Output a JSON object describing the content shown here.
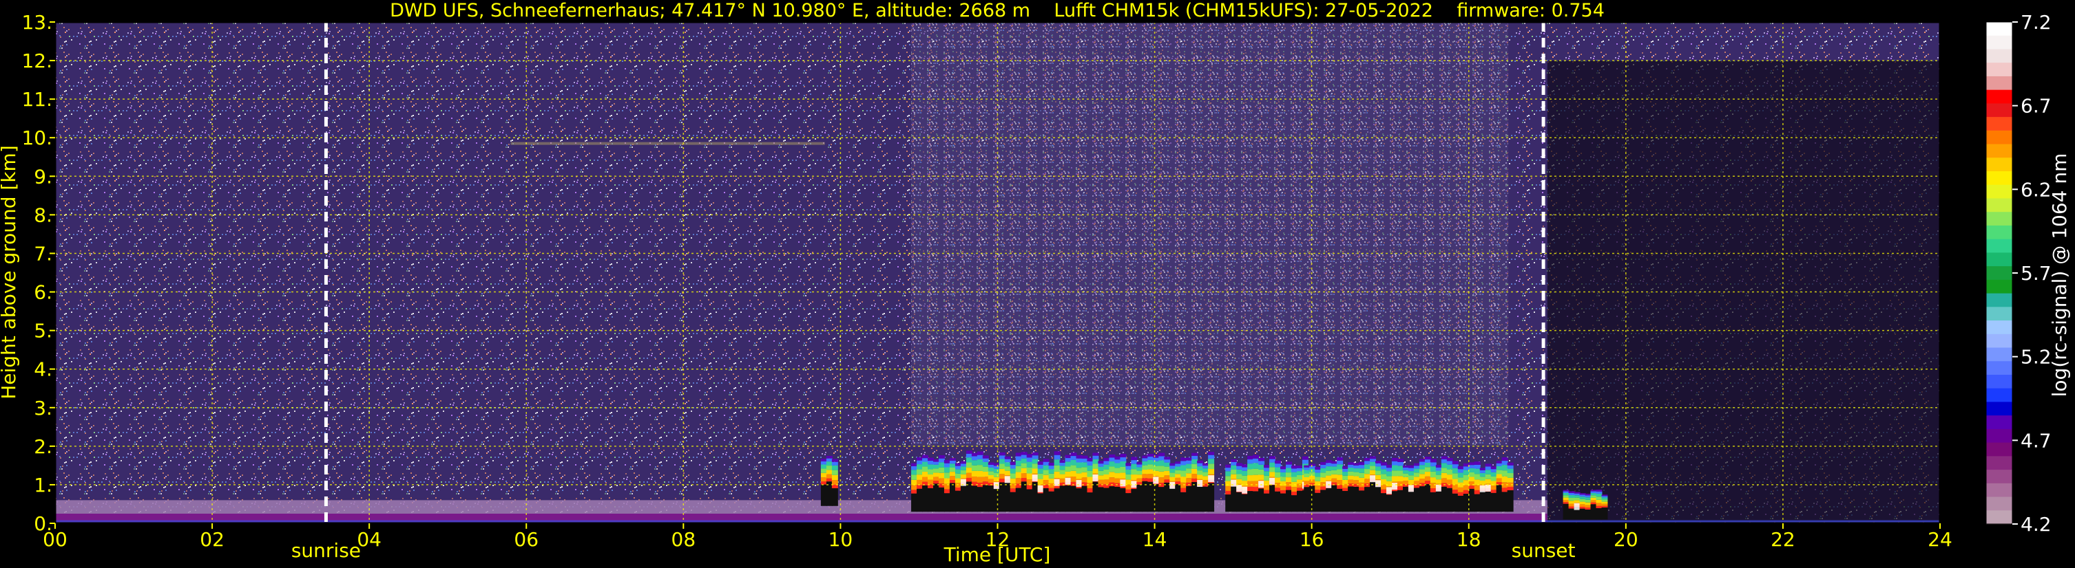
{
  "chart_data": {
    "type": "heatmap",
    "title": "DWD UFS, Schneefernerhaus; 47.417° N 10.980° E, altitude: 2668 m    Lufft CHM15k (CHM15kUFS): 27-05-2022    firmware: 0.754",
    "xlabel": "Time [UTC]",
    "ylabel": "Height above ground [km]",
    "colorbar_label": "log(rc-signal) @ 1064 nm",
    "xlim": [
      0,
      24
    ],
    "ylim": [
      0,
      13
    ],
    "x_ticks": [
      {
        "v": 0,
        "label": "00"
      },
      {
        "v": 2,
        "label": "02"
      },
      {
        "v": 4,
        "label": "04"
      },
      {
        "v": 6,
        "label": "06"
      },
      {
        "v": 8,
        "label": "08"
      },
      {
        "v": 10,
        "label": "10"
      },
      {
        "v": 12,
        "label": "12"
      },
      {
        "v": 14,
        "label": "14"
      },
      {
        "v": 16,
        "label": "16"
      },
      {
        "v": 18,
        "label": "18"
      },
      {
        "v": 20,
        "label": "20"
      },
      {
        "v": 22,
        "label": "22"
      },
      {
        "v": 24,
        "label": "24"
      }
    ],
    "y_ticks": [
      {
        "v": 0,
        "label": "0."
      },
      {
        "v": 1,
        "label": "1."
      },
      {
        "v": 2,
        "label": "2."
      },
      {
        "v": 3,
        "label": "3."
      },
      {
        "v": 4,
        "label": "4."
      },
      {
        "v": 5,
        "label": "5."
      },
      {
        "v": 6,
        "label": "6."
      },
      {
        "v": 7,
        "label": "7."
      },
      {
        "v": 8,
        "label": "8."
      },
      {
        "v": 9,
        "label": "9."
      },
      {
        "v": 10,
        "label": "10."
      },
      {
        "v": 11,
        "label": "11."
      },
      {
        "v": 12,
        "label": "12."
      },
      {
        "v": 13,
        "label": "13."
      }
    ],
    "grid": true,
    "markers": [
      {
        "label": "sunrise",
        "x": 3.45
      },
      {
        "label": "sunset",
        "x": 18.95
      }
    ],
    "colorbar": {
      "range": [
        4.2,
        7.2
      ],
      "ticks": [
        {
          "v": 7.2,
          "label": "7.2"
        },
        {
          "v": 6.7,
          "label": "6.7"
        },
        {
          "v": 6.2,
          "label": "6.2"
        },
        {
          "v": 5.7,
          "label": "5.7"
        },
        {
          "v": 5.2,
          "label": "5.2"
        },
        {
          "v": 4.7,
          "label": "4.7"
        },
        {
          "v": 4.2,
          "label": "4.2"
        }
      ],
      "colors_top_to_bottom": [
        "#ffffff",
        "#f7f2f2",
        "#f0e2e2",
        "#f2c8c8",
        "#e79a9a",
        "#ff0000",
        "#e8171a",
        "#ff4a1a",
        "#ff7a00",
        "#ffa000",
        "#ffcc00",
        "#ffee00",
        "#e9f51f",
        "#c8f03c",
        "#8ce65a",
        "#4edc78",
        "#2ed28c",
        "#1ab96e",
        "#17a03c",
        "#139d20",
        "#26b0a0",
        "#64c8c8",
        "#a0c8ff",
        "#9ab4ff",
        "#7896ff",
        "#5a78ff",
        "#3c5aff",
        "#1a3cff",
        "#0000d0",
        "#5a00b4",
        "#6a0096",
        "#7a0a78",
        "#8a2a80",
        "#9a4a8c",
        "#aa6e9c",
        "#b48ca8",
        "#c0a4b4"
      ]
    },
    "background_color": "#3a2a6a",
    "boundary_layer": {
      "top_km": 0.6,
      "color": "#a07ab0"
    },
    "cloud_segments": [
      {
        "t0": 9.75,
        "t1": 9.9,
        "base_km": 0.45,
        "top_km": 1.9
      },
      {
        "t0": 10.9,
        "t1": 14.75,
        "base_km": 0.3,
        "top_km": 1.9
      },
      {
        "t0": 14.9,
        "t1": 15.9,
        "base_km": 0.3,
        "top_km": 1.8
      },
      {
        "t0": 15.9,
        "t1": 18.5,
        "base_km": 0.3,
        "top_km": 1.75
      },
      {
        "t0": 19.2,
        "t1": 19.75,
        "base_km": 0.1,
        "top_km": 0.9
      }
    ],
    "aerosol_streak": {
      "t0": 5.8,
      "t1": 9.8,
      "height_km": 9.85
    }
  }
}
